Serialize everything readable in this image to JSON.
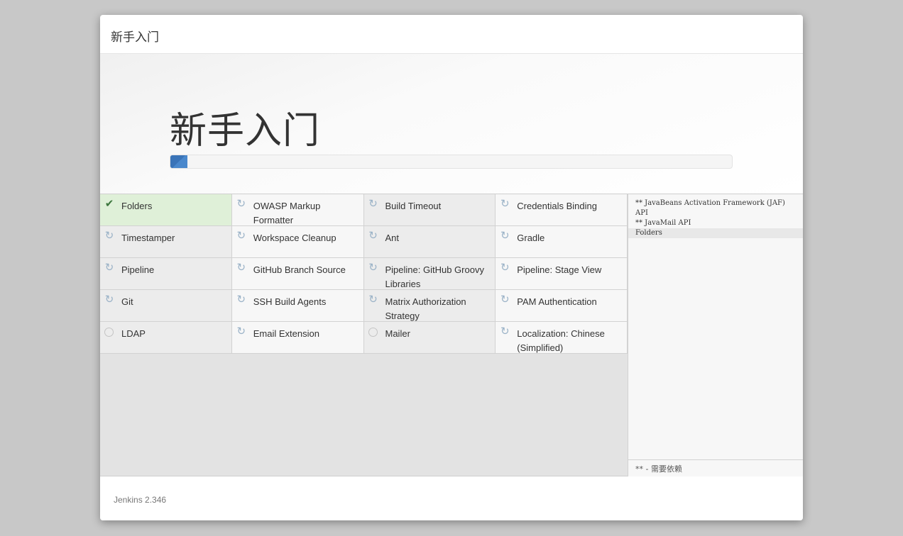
{
  "dialog": {
    "header_title": "新手入门",
    "hero_title": "新手入门",
    "progress": 0.03,
    "footer_version": "Jenkins 2.346"
  },
  "plugins": [
    {
      "name": "Folders",
      "state": "success"
    },
    {
      "name": "OWASP Markup Formatter",
      "state": "installing"
    },
    {
      "name": "Build Timeout",
      "state": "installing"
    },
    {
      "name": "Credentials Binding",
      "state": "installing"
    },
    {
      "name": "Timestamper",
      "state": "installing"
    },
    {
      "name": "Workspace Cleanup",
      "state": "installing"
    },
    {
      "name": "Ant",
      "state": "installing"
    },
    {
      "name": "Gradle",
      "state": "installing"
    },
    {
      "name": "Pipeline",
      "state": "installing"
    },
    {
      "name": "GitHub Branch Source",
      "state": "installing"
    },
    {
      "name": "Pipeline: GitHub Groovy Libraries",
      "state": "installing"
    },
    {
      "name": "Pipeline: Stage View",
      "state": "installing"
    },
    {
      "name": "Git",
      "state": "installing"
    },
    {
      "name": "SSH Build Agents",
      "state": "installing"
    },
    {
      "name": "Matrix Authorization Strategy",
      "state": "installing"
    },
    {
      "name": "PAM Authentication",
      "state": "installing"
    },
    {
      "name": "LDAP",
      "state": "pending"
    },
    {
      "name": "Email Extension",
      "state": "installing"
    },
    {
      "name": "Mailer",
      "state": "pending"
    },
    {
      "name": "Localization: Chinese (Simplified)",
      "state": "installing"
    }
  ],
  "log": {
    "lines": [
      {
        "text": "** JavaBeans Activation Framework (JAF) API",
        "current": false
      },
      {
        "text": "** JavaMail API",
        "current": false
      },
      {
        "text": "Folders",
        "current": true
      }
    ],
    "footer": "** - 需要依赖"
  },
  "colors": {
    "success_bg": "#dff0d8",
    "check": "#3c763d",
    "spinner": "#9ab2c7",
    "progress": "#3c7bbf"
  },
  "icons": {
    "success": "check-icon",
    "installing": "refresh-spinner-icon",
    "pending": "pending-circle-icon"
  }
}
